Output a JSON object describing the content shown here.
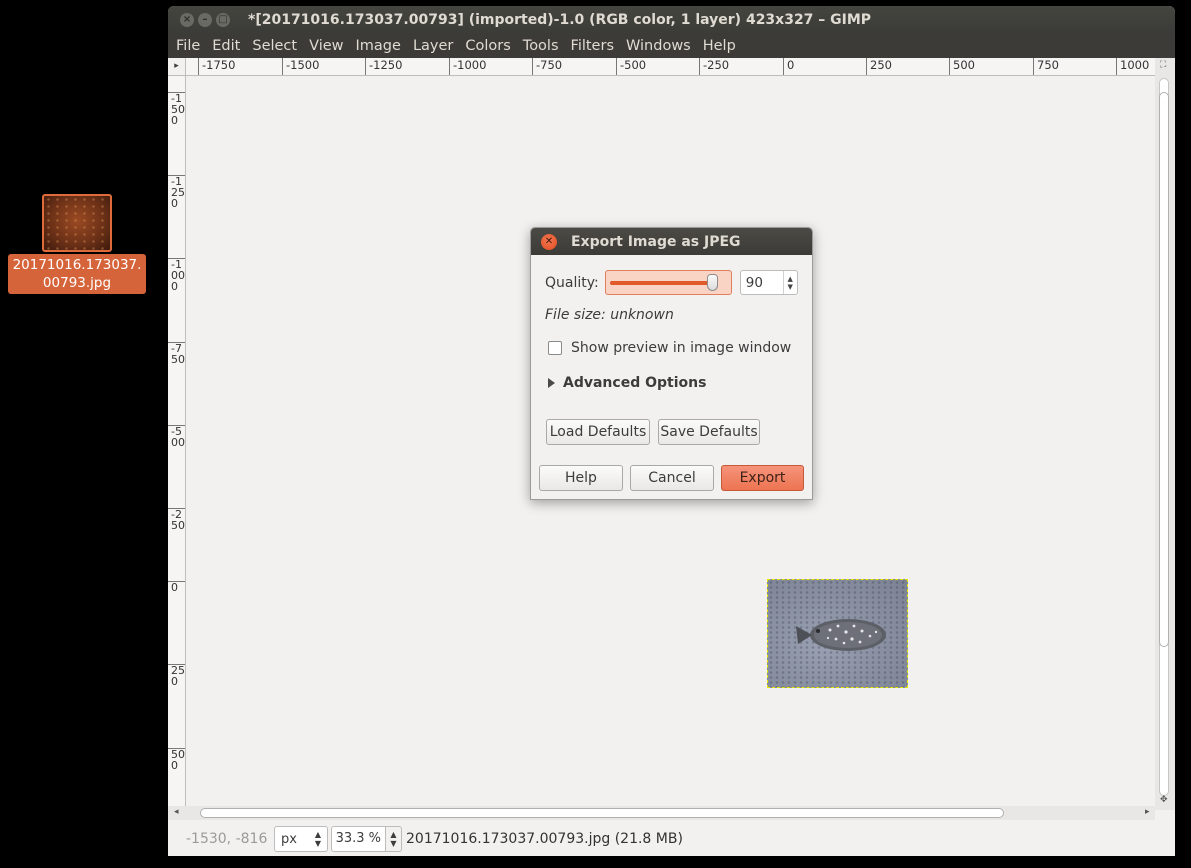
{
  "desktop": {
    "icon_label": "20171016.173037.00793.jpg"
  },
  "window": {
    "title": "*[20171016.173037.00793] (imported)-1.0 (RGB color, 1 layer) 423x327 – GIMP",
    "menu": [
      "File",
      "Edit",
      "Select",
      "View",
      "Image",
      "Layer",
      "Colors",
      "Tools",
      "Filters",
      "Windows",
      "Help"
    ]
  },
  "rulers": {
    "horizontal": [
      "-1750",
      "-1500",
      "-1250",
      "-1000",
      "-750",
      "-500",
      "-250",
      "0",
      "250",
      "500",
      "750",
      "1000"
    ],
    "vertical": [
      "-1500",
      "-1250",
      "-1000",
      "-750",
      "-500",
      "-250",
      "0",
      "250",
      "500"
    ]
  },
  "statusbar": {
    "coords": "-1530, -816",
    "unit": "px",
    "zoom": "33.3 %",
    "file_info": "20171016.173037.00793.jpg (21.8 MB)"
  },
  "dialog": {
    "title": "Export Image as JPEG",
    "quality_label": "Quality:",
    "quality_value": "90",
    "quality_fraction": 0.9,
    "file_size_text": "File size: unknown",
    "preview_label": "Show preview in image window",
    "preview_checked": false,
    "advanced_label": "Advanced Options",
    "load_defaults": "Load Defaults",
    "save_defaults": "Save Defaults",
    "help": "Help",
    "cancel": "Cancel",
    "export": "Export"
  },
  "colors": {
    "accent": "#e05a2a",
    "export_button": "#ed7452",
    "titlebar": "#3c3b37"
  }
}
